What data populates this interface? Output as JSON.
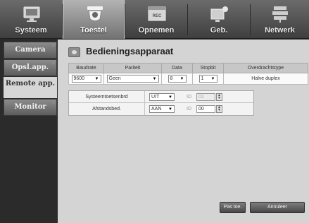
{
  "tabs": [
    {
      "label": "Systeem",
      "icon": "monitor-icon"
    },
    {
      "label": "Toestel",
      "icon": "camera-icon"
    },
    {
      "label": "Opnemen",
      "icon": "rec-icon"
    },
    {
      "label": "Geb.",
      "icon": "network-camera-icon"
    },
    {
      "label": "Netwerk",
      "icon": "network-icon"
    }
  ],
  "active_tab": "Toestel",
  "sidebar": {
    "items": [
      {
        "label": "Camera"
      },
      {
        "label": "Opsl.app."
      },
      {
        "label": "Remote app."
      },
      {
        "label": "Monitor"
      }
    ],
    "active": "Remote app."
  },
  "page": {
    "title": "Bedieningsapparaat",
    "icon": "remote-icon"
  },
  "serial": {
    "headers": [
      "Baudrate",
      "Pariteit",
      "Data",
      "Stopbit",
      "Overdrachtstype"
    ],
    "baudrate": "9600",
    "pariteit": "Geen",
    "data": "8",
    "stopbit": "1",
    "overdrachtstype": "Halve duplex"
  },
  "options": [
    {
      "label": "Systeemtoetsenbrd",
      "value": "UIT",
      "id_label": "ID",
      "id_value": "01",
      "enabled": false
    },
    {
      "label": "Afstandsbed.",
      "value": "AAN",
      "id_label": "ID",
      "id_value": "00",
      "enabled": true
    }
  ],
  "buttons": {
    "apply": "Pas toe.",
    "cancel": "Annuleer"
  },
  "colors": {
    "panel_bg": "#d4d4d4",
    "sidebar_bg": "#2b2b2b",
    "active_tab": "#a8a8a8"
  }
}
